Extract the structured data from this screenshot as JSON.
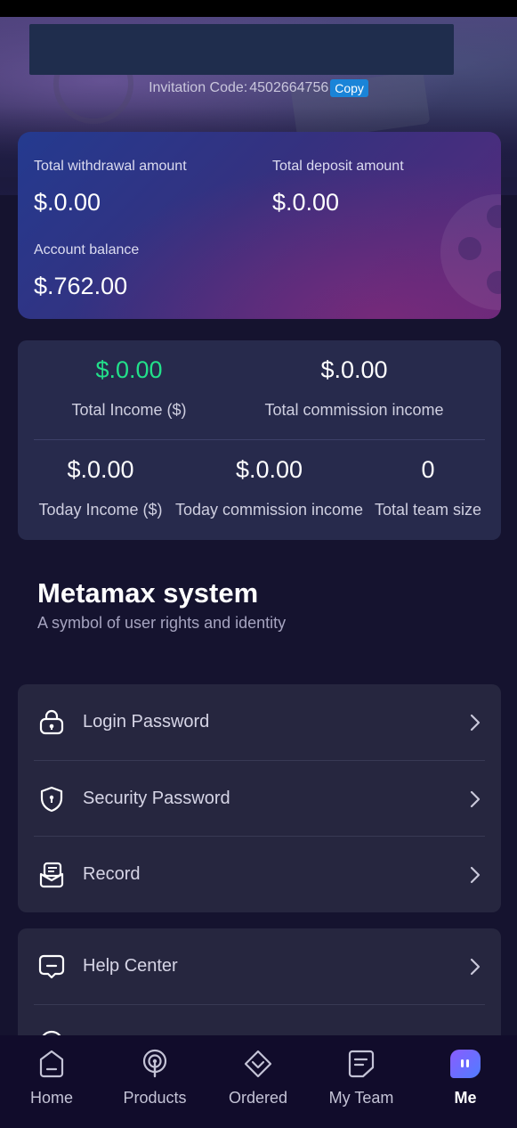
{
  "header": {
    "invitation_label": "Invitation Code:",
    "invitation_code": "4502664756",
    "copy_label": "Copy"
  },
  "balance": {
    "withdrawal_label": "Total withdrawal amount",
    "withdrawal_value": "$.0.00",
    "deposit_label": "Total deposit amount",
    "deposit_value": "$.0.00",
    "account_label": "Account balance",
    "account_value": "$.762.00"
  },
  "stats": {
    "total_income_value": "$.0.00",
    "total_income_label": "Total Income ($)",
    "total_commission_value": "$.0.00",
    "total_commission_label": "Total commission income",
    "today_income_value": "$.0.00",
    "today_income_label": "Today Income ($)",
    "today_commission_value": "$.0.00",
    "today_commission_label": "Today commission income",
    "team_size_value": "0",
    "team_size_label": "Total team size",
    "highlight_color": "#22e08a"
  },
  "system": {
    "title": "Metamax system",
    "subtitle": "A symbol of user rights and identity"
  },
  "menu": {
    "login_password": "Login Password",
    "security_password": "Security Password",
    "record": "Record",
    "help_center": "Help Center"
  },
  "tabs": {
    "home": "Home",
    "products": "Products",
    "ordered": "Ordered",
    "my_team": "My Team",
    "me": "Me"
  }
}
